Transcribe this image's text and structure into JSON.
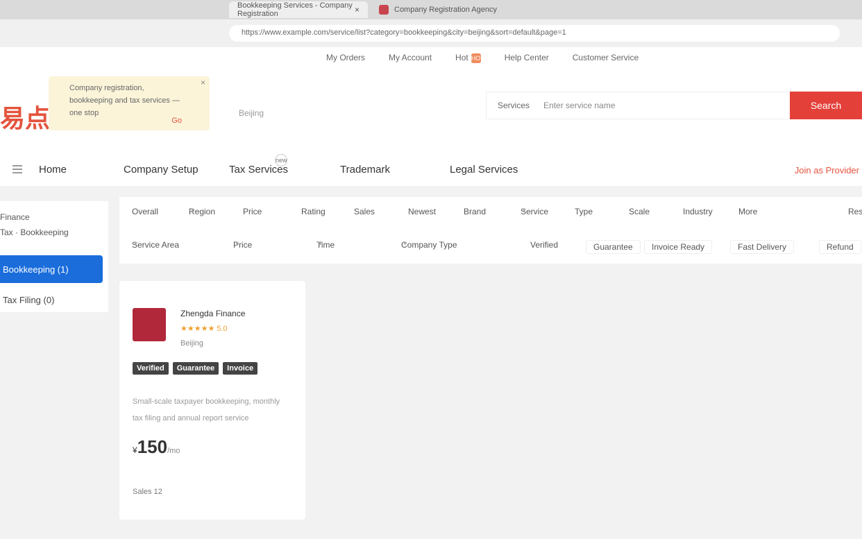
{
  "browser": {
    "active_tab": "Bookkeeping Services - Company Registration",
    "second_tab": "Company Registration Agency",
    "url": "https://www.example.com/service/list?category=bookkeeping&city=beijing&sort=default&page=1"
  },
  "header": {
    "topnav": [
      "My Orders",
      "My Account",
      "Hot",
      "Help Center",
      "Customer Service"
    ],
    "hot_badge": "HOT",
    "logo": "易点",
    "ad": {
      "text": "Company registration, bookkeeping and tax services — one stop",
      "button": "Go",
      "close": "×"
    },
    "city": "Beijing",
    "search": {
      "category": "Services",
      "placeholder": "Enter service name",
      "button": "Search"
    },
    "mainnav": [
      "Home",
      "Company Setup",
      "Tax Services",
      "Trademark",
      "Legal Services"
    ],
    "new_badge": "new",
    "right_link": "Join as Provider"
  },
  "sidebar": {
    "head1": "Finance",
    "head2": "Tax · Bookkeeping",
    "active_item": "Bookkeeping (1)",
    "other_item": "Tax Filing (0)"
  },
  "filters": {
    "row1": [
      "Overall",
      "Region",
      "Price",
      "Rating",
      "Sales",
      "Newest",
      "Brand",
      "Service",
      "Type",
      "Scale",
      "Industry",
      "More",
      "Reset"
    ],
    "row2": [
      "Service Area",
      "Price",
      "Time",
      "Company Type",
      "Verified",
      "Guarantee",
      "Invoice Ready",
      "Fast Delivery",
      "Refund"
    ]
  },
  "card": {
    "shop_name": "Zhengda Finance",
    "rating": "★★★★★ 5.0",
    "shop_sub": "Beijing",
    "tags": [
      "Verified",
      "Guarantee",
      "Invoice"
    ],
    "desc_line1": "Small-scale taxpayer bookkeeping, monthly",
    "desc_line2": "tax filing and annual report service",
    "price_currency": "¥",
    "price": "150",
    "price_unit": "/mo",
    "sales": "Sales 12"
  }
}
